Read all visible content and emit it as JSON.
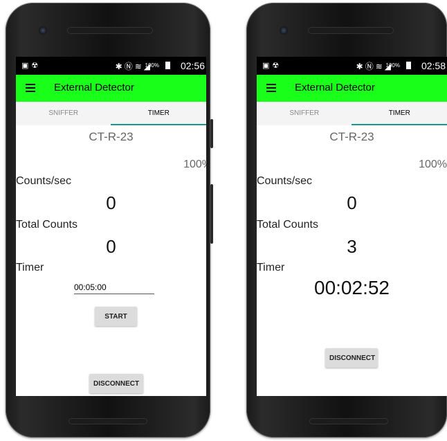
{
  "phones": [
    {
      "status_time": "02:56",
      "battery_status": "100%",
      "app_title": "External Detector",
      "tabs": [
        {
          "label": "SNIFFER",
          "active": false
        },
        {
          "label": "TIMER",
          "active": true
        }
      ],
      "device_name": "CT-R-23",
      "battery_percent": "100%",
      "counts_label": "Counts/sec",
      "counts_value": "0",
      "total_label": "Total Counts",
      "total_value": "0",
      "timer_label": "Timer",
      "timer_input_value": "00:05:00",
      "start_label": "START",
      "disconnect_label": "DISCONNECT"
    },
    {
      "status_time": "02:58",
      "battery_status": "100%",
      "app_title": "External Detector",
      "tabs": [
        {
          "label": "SNIFFER",
          "active": false
        },
        {
          "label": "TIMER",
          "active": true
        }
      ],
      "device_name": "CT-R-23",
      "battery_percent": "100%",
      "counts_label": "Counts/sec",
      "counts_value": "0",
      "total_label": "Total Counts",
      "total_value": "3",
      "timer_label": "Timer",
      "timer_display": "00:02:52",
      "disconnect_label": "DISCONNECT"
    }
  ],
  "colors": {
    "appbar": "#19ff19",
    "tab_indicator": "#139c8b"
  },
  "icons": {
    "menu": "hamburger-menu-icon",
    "status_left": [
      "gallery-icon",
      "radiation-icon"
    ],
    "status_right": [
      "bluetooth-icon",
      "nfc-icon",
      "wifi-icon",
      "signal-icon",
      "battery-icon"
    ]
  }
}
